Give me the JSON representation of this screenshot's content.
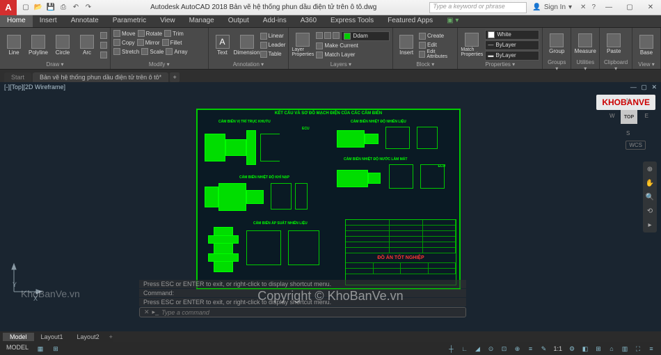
{
  "app": {
    "logo": "A",
    "title": "Autodesk AutoCAD 2018   Bản vẽ hệ thống phun dầu điện tử trên ô tô.dwg",
    "search_placeholder": "Type a keyword or phrase",
    "signin": "Sign In"
  },
  "ribbon_tabs": [
    "Home",
    "Insert",
    "Annotate",
    "Parametric",
    "View",
    "Manage",
    "Output",
    "Add-ins",
    "A360",
    "Express Tools",
    "Featured Apps"
  ],
  "ribbon": {
    "draw": {
      "label": "Draw ▾",
      "items": [
        "Line",
        "Polyline",
        "Circle",
        "Arc"
      ]
    },
    "modify": {
      "label": "Modify ▾",
      "btns": [
        [
          "Move",
          "Rotate",
          "Trim"
        ],
        [
          "Copy",
          "Mirror",
          "Fillet"
        ],
        [
          "Stretch",
          "Scale",
          "Array"
        ]
      ]
    },
    "annotation": {
      "label": "Annotation ▾",
      "items": [
        "Text",
        "Dimension"
      ],
      "sub": [
        "Linear",
        "Leader",
        "Table"
      ]
    },
    "layers": {
      "label": "Layers ▾",
      "main": "Layer Properties",
      "sub": [
        "Make Current",
        "Match Layer"
      ],
      "combo": "Ddam"
    },
    "block": {
      "label": "Block ▾",
      "items": [
        "Insert"
      ],
      "sub": [
        "Create",
        "Edit",
        "Edit Attributes"
      ]
    },
    "properties": {
      "label": "Properties ▾",
      "main": "Match Properties",
      "combos": [
        "White",
        "ByLayer",
        "ByLayer"
      ]
    },
    "groups": {
      "label": "Groups ▾",
      "item": "Group"
    },
    "utilities": {
      "label": "Utilities ▾",
      "item": "Measure"
    },
    "clipboard": {
      "label": "Clipboard ▾",
      "item": "Paste"
    },
    "view": {
      "label": "View ▾",
      "item": "Base"
    }
  },
  "file_tabs": {
    "start": "Start",
    "active": "Bản vẽ hệ thống phun dầu điện tử trên ô tô*"
  },
  "viewport": {
    "label": "[-][Top][2D Wireframe]"
  },
  "viewcube": {
    "top": "TOP",
    "n": "N",
    "s": "S",
    "e": "E",
    "w": "W",
    "wcs": "WCS"
  },
  "drawing": {
    "title": "KẾT CẤU VÀ SƠ ĐỒ MẠCH ĐIỆN CỦA CÁC CẢM BIẾN",
    "sub1": "CẢM BIẾN VỊ TRÍ TRỤC KHUỶU",
    "sub2": "CẢM BIẾN NHIỆT ĐỘ NHIÊN LIỆU",
    "sub3": "CẢM BIẾN NHIỆT ĐỘ NƯỚC LÀM MÁT",
    "sub4": "CẢM BIẾN NHIỆT ĐỘ KHÍ NẠP",
    "sub5": "CẢM BIẾN ÁP SUẤT NHIÊN LIỆU",
    "ecu": "ECU",
    "titleblock": "ĐỒ ÁN TỐT NGHIỆP"
  },
  "command": {
    "hist1": "Press ESC or ENTER to exit, or right-click to display shortcut menu.",
    "hist2": "Command:",
    "hist3": "Press ESC or ENTER to exit, or right-click to display shortcut menu.",
    "placeholder": "Type a command"
  },
  "bottom_tabs": [
    "Model",
    "Layout1",
    "Layout2"
  ],
  "status": {
    "model": "MODEL",
    "scale": "1:1"
  },
  "watermark": "Copyright © KhoBanVe.vn",
  "wm2": "KhoBanVe.vn",
  "brandlogo": "KHOBANVE"
}
